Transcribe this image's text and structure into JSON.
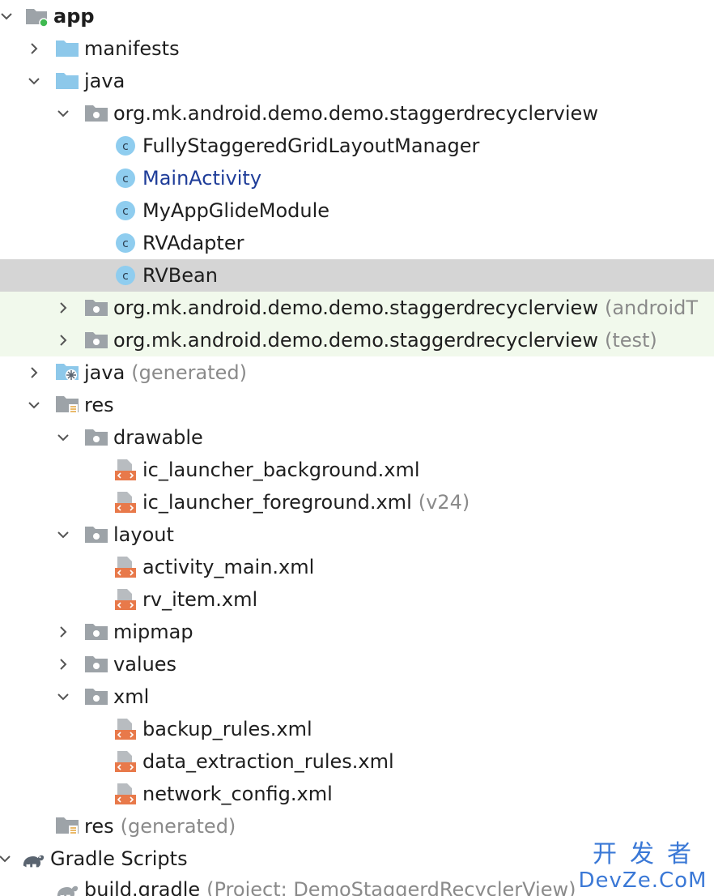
{
  "tree": {
    "app": {
      "label": "app"
    },
    "manifests": {
      "label": "manifests"
    },
    "java": {
      "label": "java"
    },
    "pkg_main": {
      "label": "org.mk.android.demo.demo.staggerdrecyclerview"
    },
    "class_fully": {
      "label": "FullyStaggeredGridLayoutManager"
    },
    "class_main_activity": {
      "label": "MainActivity"
    },
    "class_glide": {
      "label": "MyAppGlideModule"
    },
    "class_rvadapter": {
      "label": "RVAdapter"
    },
    "class_rvbean": {
      "label": "RVBean"
    },
    "pkg_android_test": {
      "label": "org.mk.android.demo.demo.staggerdrecyclerview",
      "suffix": "(androidT"
    },
    "pkg_test": {
      "label": "org.mk.android.demo.demo.staggerdrecyclerview",
      "suffix": "(test)"
    },
    "java_generated": {
      "label": "java",
      "suffix": "(generated)"
    },
    "res": {
      "label": "res"
    },
    "drawable": {
      "label": "drawable"
    },
    "ic_bg": {
      "label": "ic_launcher_background.xml"
    },
    "ic_fg": {
      "label": "ic_launcher_foreground.xml",
      "suffix": "(v24)"
    },
    "layout": {
      "label": "layout"
    },
    "activity_main": {
      "label": "activity_main.xml"
    },
    "rv_item": {
      "label": "rv_item.xml"
    },
    "mipmap": {
      "label": "mipmap"
    },
    "values": {
      "label": "values"
    },
    "xml": {
      "label": "xml"
    },
    "backup_rules": {
      "label": "backup_rules.xml"
    },
    "data_extraction": {
      "label": "data_extraction_rules.xml"
    },
    "network_config": {
      "label": "network_config.xml"
    },
    "res_generated": {
      "label": "res",
      "suffix": "(generated)"
    },
    "gradle_scripts": {
      "label": "Gradle Scripts"
    },
    "build_gradle": {
      "label": "build.gradle",
      "suffix": "(Project: DemoStaggerdRecyclerView)"
    }
  },
  "watermark": {
    "line1": "开发者",
    "line2": "DevZe.CoM"
  },
  "colors": {
    "selected_row": "#d5d5d5",
    "test_row": "#f1f9ec",
    "folder_blue": "#8dc8ea",
    "folder_gray": "#9da3a8",
    "class_circle": "#8fcdef",
    "xml_orange": "#e8794a",
    "link_blue": "#1f3d99",
    "muted_text": "#8a8a8a"
  }
}
